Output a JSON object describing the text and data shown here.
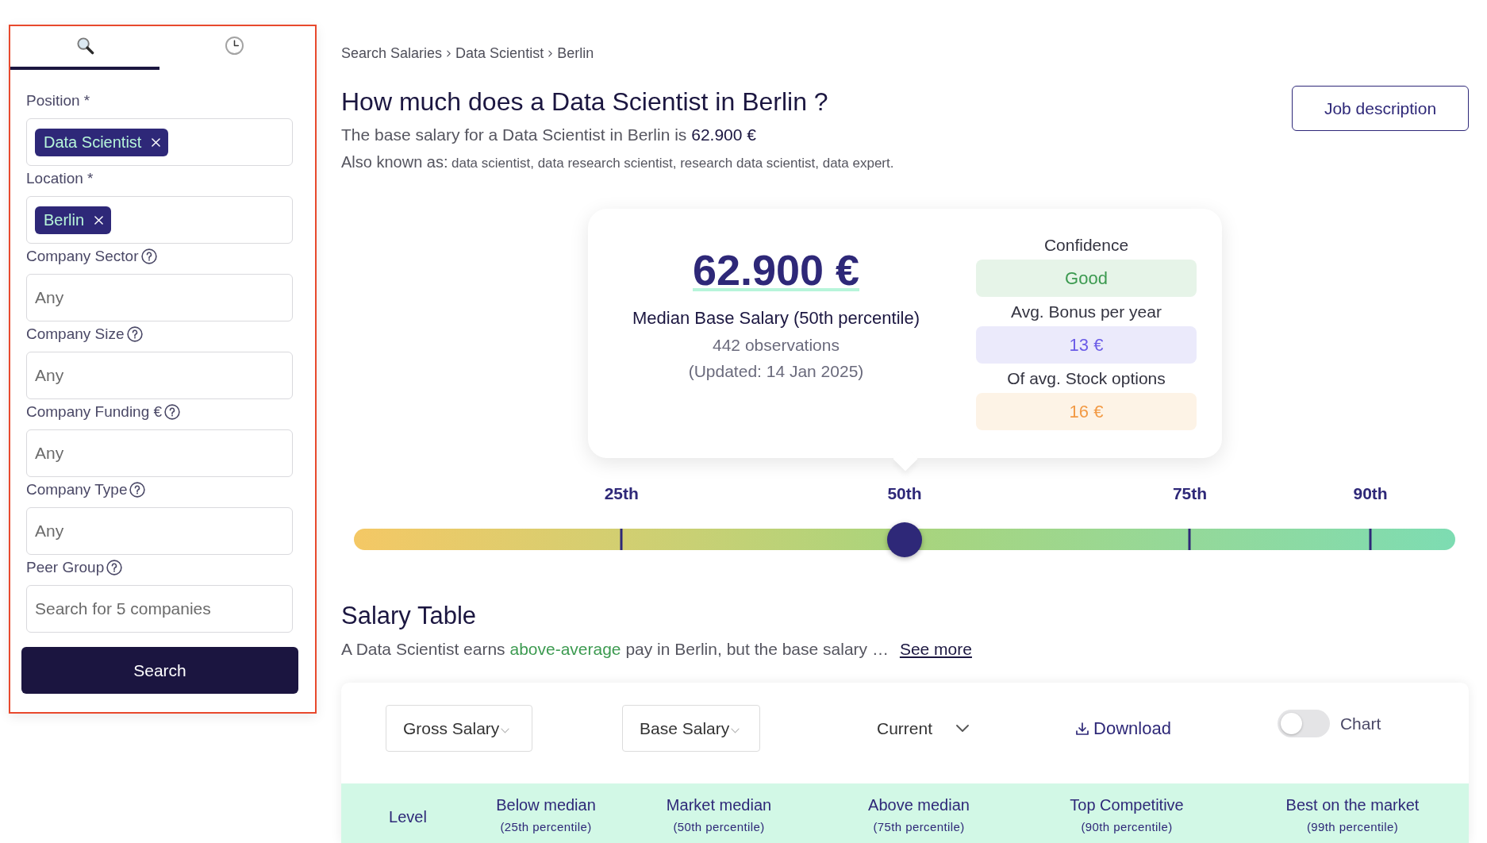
{
  "sidebar": {
    "tabs": [
      {
        "kind": "search",
        "selected": true
      },
      {
        "kind": "history",
        "selected": false
      }
    ],
    "fields": [
      {
        "kind": "tags",
        "label": "Position *",
        "help": false,
        "tags": [
          "Data Scientist"
        ]
      },
      {
        "kind": "tags",
        "label": "Location *",
        "help": false,
        "tags": [
          "Berlin"
        ]
      },
      {
        "kind": "select",
        "label": "Company Sector",
        "help": true,
        "placeholder": "Any"
      },
      {
        "kind": "select",
        "label": "Company Size",
        "help": true,
        "placeholder": "Any"
      },
      {
        "kind": "select",
        "label": "Company Funding €",
        "help": true,
        "placeholder": "Any"
      },
      {
        "kind": "select",
        "label": "Company Type",
        "help": true,
        "placeholder": "Any"
      },
      {
        "kind": "search",
        "label": "Peer Group",
        "help": true,
        "placeholder": "Search for 5 companies"
      }
    ],
    "search_button": "Search"
  },
  "breadcrumb": [
    "Search Salaries",
    "Data Scientist",
    "Berlin"
  ],
  "title": "How much does a Data Scientist in Berlin ?",
  "summary": "The base salary for a Data Scientist in Berlin is **62.900 €**",
  "also_known_as": {
    "label": "Also known as:",
    "value": "data scientist, data research scientist, research data scientist, data expert."
  },
  "job_description_button": "Job description",
  "salary_card": {
    "amount": "62.900 €",
    "caption": "Median Base Salary (50th percentile)",
    "observations": "442 observations",
    "updated": "(Updated: 14 Jan 2025)",
    "metrics": [
      {
        "kind": "confidence",
        "label": "Confidence",
        "value": "Good"
      },
      {
        "kind": "bonus",
        "label": "Avg. Bonus per year",
        "value": "13 €"
      },
      {
        "kind": "stock",
        "label": "Of avg. Stock options",
        "value": "16 €"
      }
    ]
  },
  "percentile_scale": {
    "level": 0.5,
    "markers": [
      {
        "label": "25th",
        "level": 0.243
      },
      {
        "label": "50th",
        "level": 0.5
      },
      {
        "label": "75th",
        "level": 0.759
      },
      {
        "label": "90th",
        "level": 0.923
      }
    ]
  },
  "salary_table": {
    "title": "Salary Table",
    "description": [
      {
        "text": "A Data Scientist earns ",
        "highlight": false
      },
      {
        "text": "above-average",
        "highlight": true
      },
      {
        "text": " pay in Berlin, but the base salary …",
        "highlight": false
      }
    ],
    "see_more": "See more",
    "dropdowns": [
      {
        "kind": "boxed",
        "label": "Gross Salary"
      },
      {
        "kind": "boxed",
        "label": "Base Salary"
      },
      {
        "kind": "plain",
        "label": "Current"
      }
    ],
    "download": "Download",
    "chart_toggle": {
      "label": "Chart",
      "on": false
    },
    "columns": [
      {
        "title": "Level"
      },
      {
        "title": "Below median",
        "subtitle": "(25th percentile)"
      },
      {
        "title": "Market median",
        "subtitle": "(50th percentile)"
      },
      {
        "title": "Above median",
        "subtitle": "(75th percentile)"
      },
      {
        "title": "Top Competitive",
        "subtitle": "(90th percentile)"
      },
      {
        "title": "Best on the market",
        "subtitle": "(99th percentile)"
      }
    ]
  }
}
